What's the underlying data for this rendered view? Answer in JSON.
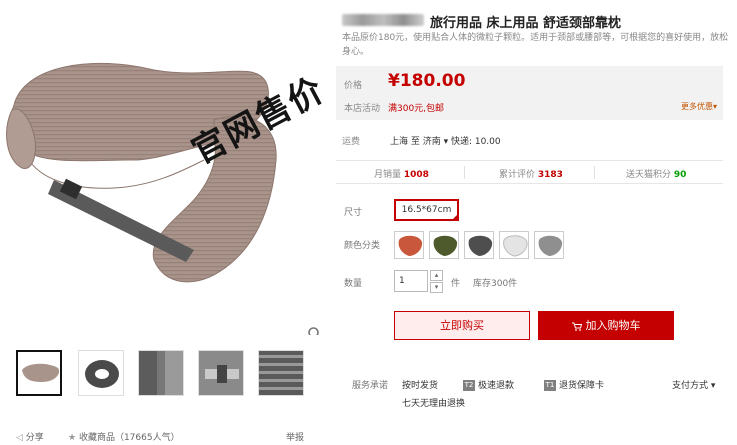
{
  "product": {
    "title": "旅行用品 床上用品 舒适颈部靠枕",
    "description": "本品原价180元，使用贴合人体的微粒子颗粒。适用于颈部或腰部等，可根据您的喜好使用，放松身心。"
  },
  "gallery": {
    "watermark": "官网售价",
    "zoom_icon": "magnifier-icon",
    "thumbnails": [
      "pillow-grey-side",
      "pillow-dark",
      "pillow-closeup",
      "pillow-buckle",
      "pillow-stripe-fabric"
    ]
  },
  "share_bar": {
    "share": "分享",
    "favorite": "收藏商品（17665人气）",
    "report": "举报"
  },
  "price": {
    "label": "价格",
    "value": "¥180.00",
    "promo_label": "本店活动",
    "promo_value": "满300元,包邮",
    "more_promos": "更多优惠▾"
  },
  "shipping": {
    "label": "运费",
    "route": "上海 至 济南 ▾  快递: 10.00"
  },
  "stats": {
    "monthly_label": "月销量",
    "monthly_value": "1008",
    "reviews_label": "累计评价",
    "reviews_value": "3183",
    "points_label": "送天猫积分",
    "points_value": "90"
  },
  "options": {
    "size_label": "尺寸",
    "size_value": "16.5*67cm",
    "color_label": "颜色分类",
    "qty_label": "数量",
    "qty_value": "1",
    "unit": "件",
    "stock": "库存300件",
    "colors": [
      "#c8573b",
      "#4f5a2c",
      "#4e4e4e",
      "#e4e4e4",
      "#8f8f8f"
    ]
  },
  "actions": {
    "buy_now": "立即购买",
    "add_to_cart": "加入购物车"
  },
  "services": {
    "label": "服务承诺",
    "items": [
      "按时发货",
      "极速退款",
      "退货保障卡"
    ],
    "badges": [
      "T2",
      "T1"
    ],
    "extra": "七天无理由退换",
    "payment": "支付方式 ▾"
  },
  "colors": {
    "accent": "#c40000",
    "green": "#00a000"
  }
}
